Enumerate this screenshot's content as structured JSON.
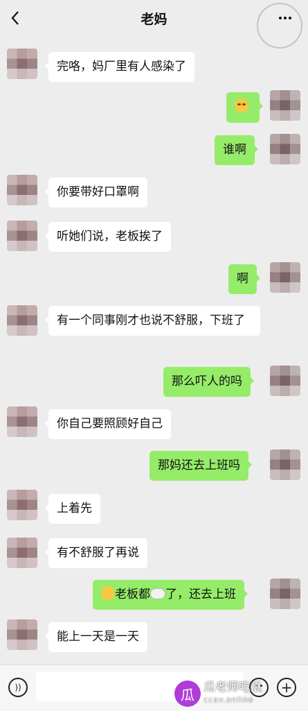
{
  "header": {
    "title": "老妈",
    "back_icon": "chevron-left-icon",
    "more_icon": "more-dots-icon"
  },
  "messages": [
    {
      "side": "left",
      "text": "完咯，妈厂里有人感染了"
    },
    {
      "side": "right",
      "emoji": "crying-laugh-emoji"
    },
    {
      "side": "right",
      "text": "谁啊"
    },
    {
      "side": "left",
      "text": "你要带好口罩啊"
    },
    {
      "side": "left",
      "text": "听她们说，老板挨了"
    },
    {
      "side": "right",
      "text": "啊"
    },
    {
      "side": "left",
      "text": "有一个同事刚才也说不舒服，下班了"
    },
    {
      "side": "right",
      "text": "那么吓人的吗"
    },
    {
      "side": "left",
      "text": "你自己要照顾好自己"
    },
    {
      "side": "right",
      "text": "那妈还去上班吗"
    },
    {
      "side": "left",
      "text": "上着先"
    },
    {
      "side": "left",
      "text": "有不舒服了再说"
    },
    {
      "side": "right",
      "text_part1": "老板都",
      "text_part2": "了，还去上班",
      "emojis": [
        "unamused-emoji",
        "sheep-emoji"
      ]
    },
    {
      "side": "left",
      "text": "能上一天是一天"
    }
  ],
  "input_bar": {
    "voice_icon": "voice-icon",
    "emoji_icon": "emoji-icon",
    "plus_icon": "plus-icon"
  },
  "watermark": {
    "logo_glyph": "瓜",
    "name": "瓜老师吃瓜",
    "site": "ccav.online"
  },
  "colors": {
    "background": "#ededed",
    "bubble_self": "#95ec69",
    "bubble_other": "#ffffff"
  }
}
